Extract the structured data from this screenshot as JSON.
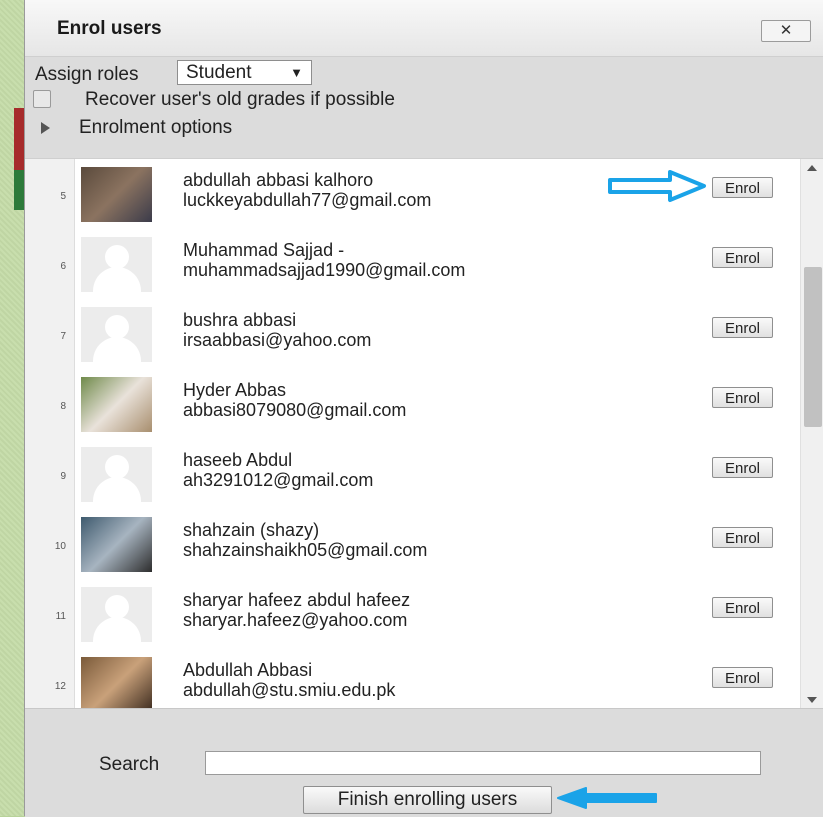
{
  "dialog": {
    "title": "Enrol users",
    "close_label": "✕"
  },
  "options": {
    "assign_roles_label": "Assign roles",
    "role_selected": "Student",
    "recover_label": "Recover user's old grades if possible",
    "recover_checked": false,
    "enrolment_options_label": "Enrolment options"
  },
  "users": [
    {
      "index": "5",
      "name": "abdullah abbasi kalhoro",
      "email": "luckkeyabdullah77@gmail.com",
      "avatar": "photo",
      "enrol_label": "Enrol"
    },
    {
      "index": "6",
      "name": "Muhammad Sajjad -",
      "email": "muhammadsajjad1990@gmail.com",
      "avatar": "default",
      "enrol_label": "Enrol"
    },
    {
      "index": "7",
      "name": "bushra abbasi",
      "email": "irsaabbasi@yahoo.com",
      "avatar": "default",
      "enrol_label": "Enrol"
    },
    {
      "index": "8",
      "name": "Hyder Abbas",
      "email": "abbasi8079080@gmail.com",
      "avatar": "photo",
      "enrol_label": "Enrol"
    },
    {
      "index": "9",
      "name": "haseeb Abdul",
      "email": "ah3291012@gmail.com",
      "avatar": "default",
      "enrol_label": "Enrol"
    },
    {
      "index": "10",
      "name": "shahzain (shazy)",
      "email": "shahzainshaikh05@gmail.com",
      "avatar": "photo",
      "enrol_label": "Enrol"
    },
    {
      "index": "11",
      "name": "sharyar hafeez abdul hafeez",
      "email": "sharyar.hafeez@yahoo.com",
      "avatar": "default",
      "enrol_label": "Enrol"
    },
    {
      "index": "12",
      "name": "Abdullah Abbasi",
      "email": "abdullah@stu.smiu.edu.pk",
      "avatar": "photo",
      "enrol_label": "Enrol"
    }
  ],
  "footer": {
    "search_label": "Search",
    "search_value": "",
    "finish_label": "Finish enrolling users"
  },
  "colors": {
    "annotation_arrow": "#1aa3e8"
  }
}
